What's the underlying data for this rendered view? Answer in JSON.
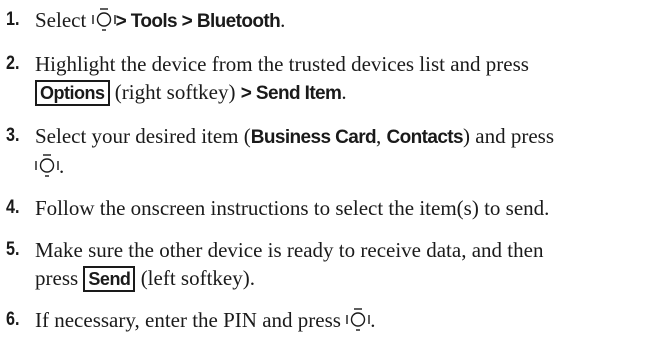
{
  "steps": [
    {
      "number": "1.",
      "select": "Select",
      "path": "> Tools > Bluetooth",
      "end": "."
    },
    {
      "number": "2.",
      "line1": "Highlight the device from the trusted devices list and press",
      "softkey": "Options",
      "softkey_desc": "(right softkey)",
      "path": "> Send Item",
      "end": "."
    },
    {
      "number": "3.",
      "lead": "Select your desired item (",
      "item1": "Business Card",
      "sep": ", ",
      "item2": "Contacts",
      "tail": ") and press",
      "end": "."
    },
    {
      "number": "4.",
      "text": "Follow the onscreen instructions to select the item(s) to send."
    },
    {
      "number": "5.",
      "line1": "Make sure the other device is ready to receive data, and then",
      "press": "press",
      "softkey": "Send",
      "softkey_desc": "(left softkey).",
      "end": ""
    },
    {
      "number": "6.",
      "text": "If necessary, enter the PIN and press",
      "end": "."
    }
  ],
  "icons": {
    "nav_key": "navigation-key-icon"
  }
}
